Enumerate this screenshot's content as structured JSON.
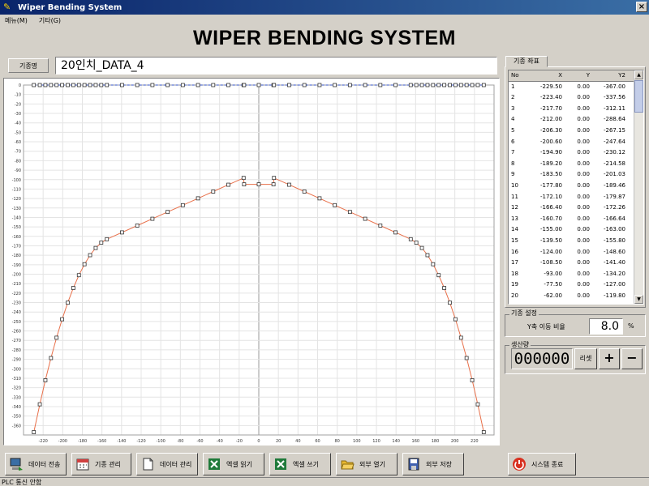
{
  "window": {
    "title": "Wiper Bending System",
    "close_glyph": "×"
  },
  "menu": [
    "메뉴(M)",
    "기타(G)"
  ],
  "header": {
    "title": "WIPER BENDING SYSTEM"
  },
  "model": {
    "label": "기종명",
    "value": "20인치_DATA_4"
  },
  "coords": {
    "tab_label": "기종 좌표",
    "columns": [
      "No",
      "X",
      "Y",
      "Y2"
    ],
    "rows": [
      [
        "1",
        "-229.50",
        "0.00",
        "-367.00"
      ],
      [
        "2",
        "-223.40",
        "0.00",
        "-337.56"
      ],
      [
        "3",
        "-217.70",
        "0.00",
        "-312.11"
      ],
      [
        "4",
        "-212.00",
        "0.00",
        "-288.64"
      ],
      [
        "5",
        "-206.30",
        "0.00",
        "-267.15"
      ],
      [
        "6",
        "-200.60",
        "0.00",
        "-247.64"
      ],
      [
        "7",
        "-194.90",
        "0.00",
        "-230.12"
      ],
      [
        "8",
        "-189.20",
        "0.00",
        "-214.58"
      ],
      [
        "9",
        "-183.50",
        "0.00",
        "-201.03"
      ],
      [
        "10",
        "-177.80",
        "0.00",
        "-189.46"
      ],
      [
        "11",
        "-172.10",
        "0.00",
        "-179.87"
      ],
      [
        "12",
        "-166.40",
        "0.00",
        "-172.26"
      ],
      [
        "13",
        "-160.70",
        "0.00",
        "-166.64"
      ],
      [
        "14",
        "-155.00",
        "0.00",
        "-163.00"
      ],
      [
        "15",
        "-139.50",
        "0.00",
        "-155.80"
      ],
      [
        "16",
        "-124.00",
        "0.00",
        "-148.60"
      ],
      [
        "17",
        "-108.50",
        "0.00",
        "-141.40"
      ],
      [
        "18",
        "-93.00",
        "0.00",
        "-134.20"
      ],
      [
        "19",
        "-77.50",
        "0.00",
        "-127.00"
      ],
      [
        "20",
        "-62.00",
        "0.00",
        "-119.80"
      ]
    ]
  },
  "settings": {
    "label": "기종 설정",
    "ratio_label": "Y축 이동 비율",
    "ratio_value": "8.0",
    "ratio_unit": "%"
  },
  "production": {
    "label": "생산량",
    "count": "000000",
    "reset_label": "리셋",
    "plus_label": "+",
    "minus_label": "−"
  },
  "toolbar": {
    "data_transfer": "데이터 전송",
    "model_manage": "기종 관리",
    "data_manage": "데이터 관리",
    "excel_read": "엑셀 읽기",
    "excel_write": "엑셀 쓰기",
    "external_open": "외부 열기",
    "external_save": "외부 저장",
    "system_exit": "시스템 종료"
  },
  "status": {
    "text": "PLC 통신 안함"
  },
  "chart_data": {
    "type": "line",
    "xlim": [
      -240,
      240
    ],
    "ylim": [
      -370,
      0
    ],
    "x_ticks": [
      -220,
      -200,
      -180,
      -160,
      -140,
      -120,
      -100,
      -80,
      -60,
      -40,
      -20,
      0,
      20,
      40,
      60,
      80,
      100,
      120,
      140,
      160,
      180,
      200,
      220
    ],
    "y_ticks": [
      0,
      -10,
      -20,
      -30,
      -40,
      -50,
      -60,
      -70,
      -80,
      -90,
      -100,
      -110,
      -120,
      -130,
      -140,
      -150,
      -160,
      -170,
      -180,
      -190,
      -200,
      -210,
      -220,
      -230,
      -240,
      -250,
      -260,
      -270,
      -280,
      -290,
      -300,
      -310,
      -320,
      -330,
      -340,
      -350,
      -360
    ],
    "grid": true,
    "series": [
      {
        "color": "#e8704a",
        "marker": "square",
        "x": [
          -229.5,
          -223.4,
          -217.7,
          -212.0,
          -206.3,
          -200.6,
          -194.9,
          -189.2,
          -183.5,
          -177.8,
          -172.1,
          -166.4,
          -160.7,
          -155.0,
          -139.5,
          -124.0,
          -108.5,
          -93.0,
          -77.5,
          -62.0,
          -46.5,
          -31.0,
          -15.5,
          -15.0,
          0.0,
          15.0,
          15.5,
          31.0,
          46.5,
          62.0,
          77.5,
          93.0,
          108.5,
          124.0,
          139.5,
          155.0,
          160.7,
          166.4,
          172.1,
          177.8,
          183.5,
          189.2,
          194.9,
          200.6,
          206.3,
          212.0,
          217.7,
          223.4,
          229.5
        ],
        "y": [
          -367.0,
          -337.56,
          -312.11,
          -288.64,
          -267.15,
          -247.64,
          -230.12,
          -214.58,
          -201.03,
          -189.46,
          -179.87,
          -172.26,
          -166.64,
          -163.0,
          -155.8,
          -148.6,
          -141.4,
          -134.2,
          -127.0,
          -119.8,
          -112.6,
          -105.4,
          -98.2,
          -105.0,
          -105.0,
          -105.0,
          -98.2,
          -105.4,
          -112.6,
          -119.8,
          -127.0,
          -134.2,
          -141.4,
          -148.6,
          -155.8,
          -163.0,
          -166.64,
          -172.26,
          -179.87,
          -189.46,
          -201.03,
          -214.58,
          -230.12,
          -247.64,
          -267.15,
          -288.64,
          -312.11,
          -337.56,
          -367.0
        ]
      },
      {
        "color": "#3050c8",
        "marker": "square",
        "x": [
          -229.5,
          -223.4,
          -217.7,
          -212.0,
          -206.3,
          -200.6,
          -194.9,
          -189.2,
          -183.5,
          -177.8,
          -172.1,
          -166.4,
          -160.7,
          -155.0,
          -139.5,
          -124.0,
          -108.5,
          -93.0,
          -77.5,
          -62.0,
          -46.5,
          -31.0,
          -15.5,
          -15.0,
          0.0,
          15.0,
          15.5,
          31.0,
          46.5,
          62.0,
          77.5,
          93.0,
          108.5,
          124.0,
          139.5,
          155.0,
          160.7,
          166.4,
          172.1,
          177.8,
          183.5,
          189.2,
          194.9,
          200.6,
          206.3,
          212.0,
          217.7,
          223.4,
          229.5
        ],
        "y": [
          0,
          0,
          0,
          0,
          0,
          0,
          0,
          0,
          0,
          0,
          0,
          0,
          0,
          0,
          0,
          0,
          0,
          0,
          0,
          0,
          0,
          0,
          0,
          0,
          0,
          0,
          0,
          0,
          0,
          0,
          0,
          0,
          0,
          0,
          0,
          0,
          0,
          0,
          0,
          0,
          0,
          0,
          0,
          0,
          0,
          0,
          0,
          0,
          0
        ]
      }
    ]
  }
}
